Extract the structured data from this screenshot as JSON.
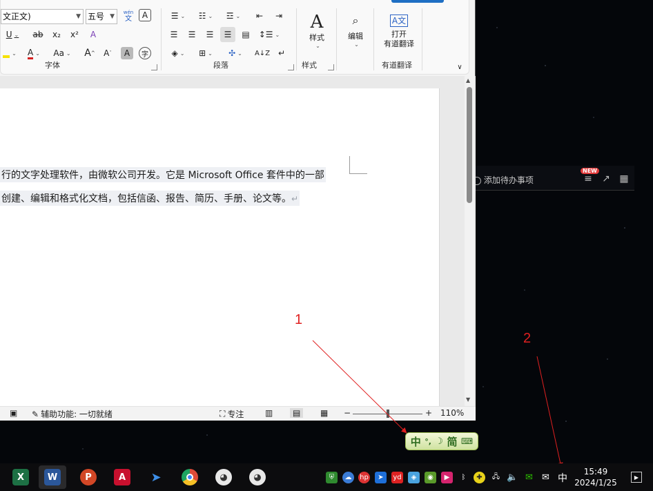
{
  "ribbon": {
    "font_group": {
      "label": "字体",
      "font_name": "文正文)",
      "font_size": "五号",
      "phonetic_top": "wén",
      "phonetic_bottom": "文",
      "char_border": "A",
      "underline": "U",
      "strike": "ab",
      "subscript": "x₂",
      "superscript": "x²",
      "clear_format": "A",
      "font_color": "A",
      "change_case": "Aa",
      "grow_font": "A",
      "shrink_font": "A",
      "char_shading": "A",
      "enclose_char": "字"
    },
    "paragraph_group": {
      "label": "段落"
    },
    "styles_group": {
      "label": "样式",
      "button": "样式"
    },
    "editing_group": {
      "button": "编辑"
    },
    "youdao_group": {
      "label": "有道翻译",
      "button_line1": "打开",
      "button_line2": "有道翻译"
    }
  },
  "document": {
    "line1": "行的文字处理软件，由微软公司开发。它是 Microsoft  Office 套件中的一部",
    "line2": "创建、编辑和格式化文档，包括信函、报告、简历、手册、论文等。",
    "para_mark": "↵"
  },
  "statusbar": {
    "accessibility": "辅助功能: 一切就绪",
    "focus": "专注",
    "zoom_minus": "−",
    "zoom_plus": "+",
    "zoom_level": "110%",
    "zoom_fraction": 0.5
  },
  "notification_panel": {
    "todo": "添加待办事项",
    "new_badge": "NEW"
  },
  "annotations": {
    "label1": "1",
    "label2": "2"
  },
  "ime_bar": {
    "lang": "中",
    "mode": "简"
  },
  "taskbar": {
    "apps": [
      {
        "name": "excel",
        "glyph": "X",
        "color": "#1d7044"
      },
      {
        "name": "word",
        "glyph": "W",
        "color": "#2b579a"
      },
      {
        "name": "powerpoint",
        "glyph": "P",
        "color": "#d24726"
      },
      {
        "name": "autocad",
        "glyph": "A",
        "color": "#c8102e"
      },
      {
        "name": "feishu",
        "glyph": "➤",
        "color": "#3370ff"
      },
      {
        "name": "chrome",
        "glyph": "",
        "color": "#dd4b39"
      },
      {
        "name": "panda",
        "glyph": "◕",
        "color": "#888888"
      },
      {
        "name": "panda2",
        "glyph": "◕",
        "color": "#888888"
      }
    ],
    "ime_indicator": "中",
    "time": "15:49",
    "date": "2024/1/25"
  }
}
